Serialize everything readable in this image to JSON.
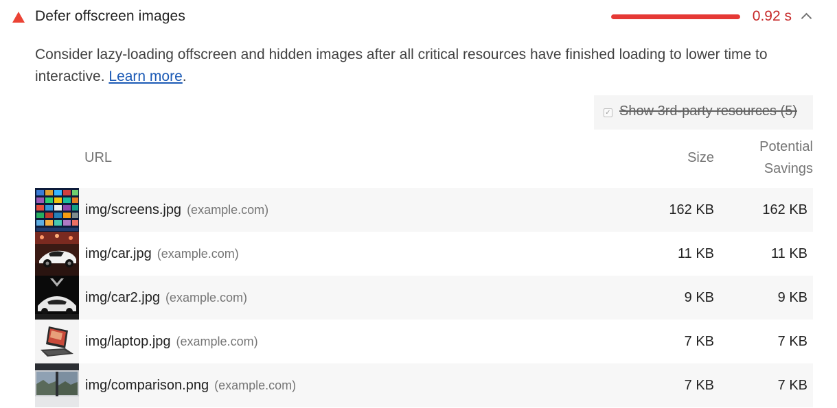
{
  "audit": {
    "title": "Defer offscreen images",
    "savings_value": "0.92 s",
    "savings_fraction": 1.0,
    "status_color": "#eb4335",
    "description_text": "Consider lazy-loading offscreen and hidden images after all critical resources have finished loading to lower time to interactive. ",
    "learn_more_label": "Learn more",
    "description_end": "."
  },
  "third_party": {
    "checkbox_glyph": "✓",
    "label": "Show 3rd-party resources (5)"
  },
  "table": {
    "headers": {
      "url": "URL",
      "size": "Size",
      "savings_line1": "Potential",
      "savings_line2": "Savings"
    },
    "rows": [
      {
        "url": "img/screens.jpg",
        "host": "(example.com)",
        "size": "162 KB",
        "savings": "162 KB",
        "thumb": "screens-thumbnail"
      },
      {
        "url": "img/car.jpg",
        "host": "(example.com)",
        "size": "11 KB",
        "savings": "11 KB",
        "thumb": "car-thumbnail"
      },
      {
        "url": "img/car2.jpg",
        "host": "(example.com)",
        "size": "9 KB",
        "savings": "9 KB",
        "thumb": "car2-thumbnail"
      },
      {
        "url": "img/laptop.jpg",
        "host": "(example.com)",
        "size": "7 KB",
        "savings": "7 KB",
        "thumb": "laptop-thumbnail"
      },
      {
        "url": "img/comparison.png",
        "host": "(example.com)",
        "size": "7 KB",
        "savings": "7 KB",
        "thumb": "comparison-thumbnail"
      }
    ]
  }
}
